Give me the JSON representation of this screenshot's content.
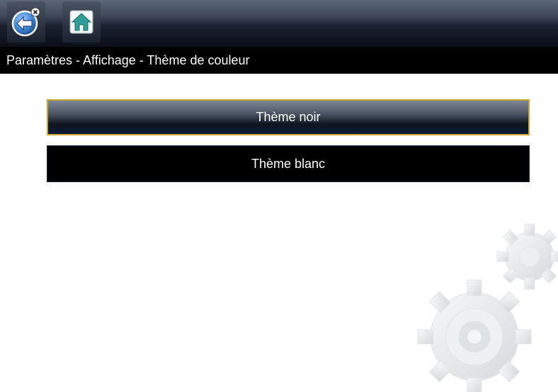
{
  "toolbar": {
    "back_icon": "back-arrow-icon",
    "home_icon": "home-icon"
  },
  "title": "Paramètres - Affichage - Thème de couleur",
  "menu": {
    "items": [
      {
        "label": "Thème noir",
        "selected": true
      },
      {
        "label": "Thème blanc",
        "selected": false
      }
    ]
  },
  "colors": {
    "selection_border": "#c9a531",
    "toolbar_dark": "#0a0f18",
    "home_icon": "#3aa9a1"
  }
}
